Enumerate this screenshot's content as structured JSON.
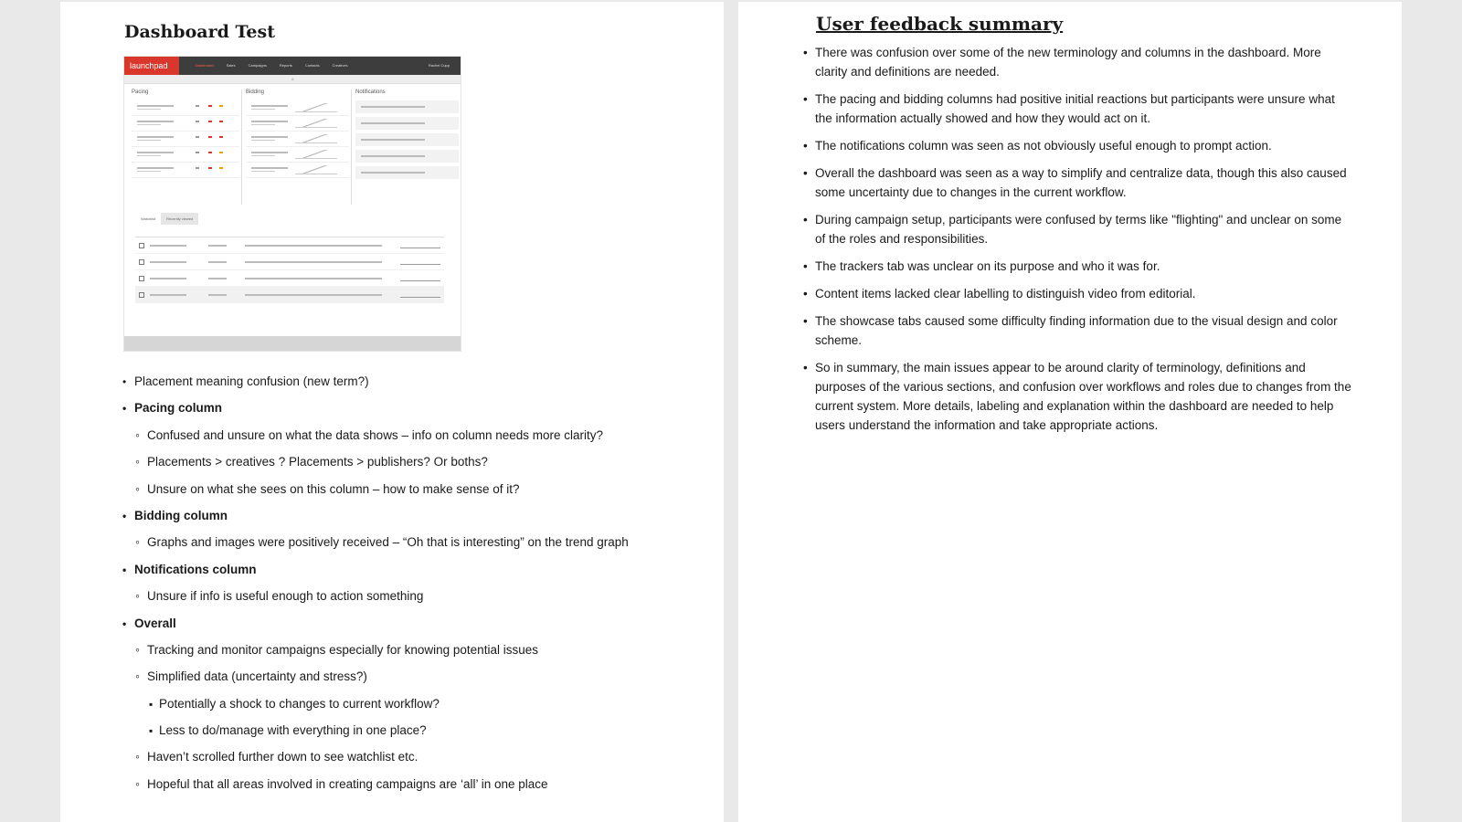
{
  "left_page": {
    "title": "Dashboard Test",
    "embedded_screenshot": {
      "logo": "launchpad",
      "nav": [
        "Dashboard",
        "Sales",
        "Campaigns",
        "Reports",
        "Contacts",
        "Creatives"
      ],
      "user": "Rachel Cupp",
      "columns": [
        "Pacing",
        "Bidding",
        "Notifications"
      ],
      "tabs": [
        "Watchlist",
        "Recently viewed"
      ]
    },
    "bullets": [
      {
        "level": 1,
        "bold": false,
        "text": "Placement meaning confusion (new term?)"
      },
      {
        "level": 1,
        "bold": true,
        "text": "Pacing column"
      },
      {
        "level": 2,
        "bold": false,
        "text": "Confused and unsure on what the data shows – info on column needs more clarity?"
      },
      {
        "level": 2,
        "bold": false,
        "text": "Placements > creatives ? Placements > publishers? Or boths?"
      },
      {
        "level": 2,
        "bold": false,
        "text": "Unsure on what she sees on this column – how to make sense of it?"
      },
      {
        "level": 1,
        "bold": true,
        "text": "Bidding column"
      },
      {
        "level": 2,
        "bold": false,
        "text": "Graphs and images were positively received – “Oh that is interesting” on the trend graph"
      },
      {
        "level": 1,
        "bold": true,
        "text": "Notifications column"
      },
      {
        "level": 2,
        "bold": false,
        "text": "Unsure if info is useful enough to action something"
      },
      {
        "level": 1,
        "bold": true,
        "text": "Overall"
      },
      {
        "level": 2,
        "bold": false,
        "text": "Tracking and monitor campaigns especially for knowing potential issues"
      },
      {
        "level": 2,
        "bold": false,
        "text": "Simplified data (uncertainty and stress?)"
      },
      {
        "level": 3,
        "bold": false,
        "text": "Potentially a shock to changes to current workflow?"
      },
      {
        "level": 3,
        "bold": false,
        "text": "Less to do/manage with everything in one place?"
      },
      {
        "level": 2,
        "bold": false,
        "text": "Haven’t scrolled further down to see watchlist etc."
      },
      {
        "level": 2,
        "bold": false,
        "text": "Hopeful that all areas involved in creating campaigns are ‘all’ in one place"
      }
    ]
  },
  "right_page": {
    "title": "User feedback summary",
    "bullets": [
      "There was confusion over some of the new terminology and columns in the dashboard. More clarity and definitions are needed.",
      "The pacing and bidding columns had positive initial reactions but participants were unsure what the information actually showed and how they would act on it.",
      "The notifications column was seen as not obviously useful enough to prompt action.",
      "Overall the dashboard was seen as a way to simplify and centralize data, though this also caused some uncertainty due to changes in the current workflow.",
      "During campaign setup, participants were confused by terms like \"flighting\" and unclear on some of the roles and responsibilities.",
      "The trackers tab was unclear on its purpose and who it was for.",
      "Content items lacked clear labelling to distinguish video from editorial.",
      "The showcase tabs caused some difficulty finding information due to the visual design and color scheme.",
      "So in summary, the main issues appear to be around clarity of terminology, definitions and purposes of the various sections, and confusion over workflows and roles due to changes from the current system. More details, labeling and explanation within the dashboard are needed to help users understand the information and take appropriate actions."
    ]
  }
}
